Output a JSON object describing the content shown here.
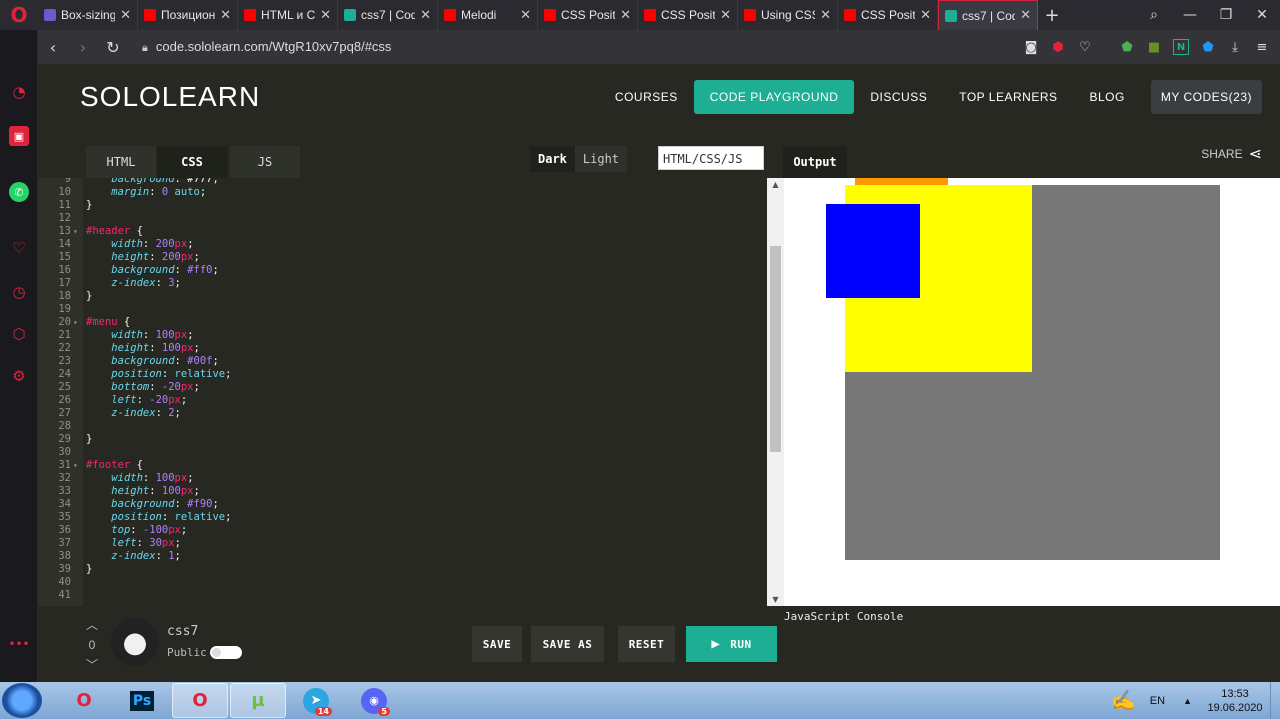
{
  "browser": {
    "tabs": [
      {
        "label": "Box-sizing",
        "color": "#6a5acd"
      },
      {
        "label": "Позицион",
        "color": "#ff0000"
      },
      {
        "label": "HTML и C",
        "color": "#ff0000"
      },
      {
        "label": "css7 | Cod",
        "color": "#1dae93"
      },
      {
        "label": "Melodi",
        "color": "#ff0000"
      },
      {
        "label": "CSS Positi",
        "color": "#ff0000"
      },
      {
        "label": "CSS Positi",
        "color": "#ff0000"
      },
      {
        "label": "Using CSS",
        "color": "#ff0000"
      },
      {
        "label": "CSS Positi",
        "color": "#ff0000"
      },
      {
        "label": "css7 | Cod",
        "color": "#1dae93"
      }
    ],
    "url": "code.sololearn.com/WtgR10xv7pq8/#css"
  },
  "header": {
    "logo": "SOLOLEARN",
    "nav": {
      "courses": "COURSES",
      "playground": "CODE PLAYGROUND",
      "discuss": "DISCUSS",
      "top": "TOP LEARNERS",
      "blog": "BLOG",
      "mycodes": "MY CODES(23)"
    }
  },
  "editor": {
    "tabs": {
      "html": "HTML",
      "css": "CSS",
      "js": "JS"
    },
    "theme": {
      "dark": "Dark",
      "light": "Light"
    },
    "lang": "HTML/CSS/JS",
    "output_tab": "Output",
    "share": "SHARE"
  },
  "code": {
    "lines": [
      {
        "n": "9",
        "html": "    <span class='prop'>background</span>: #777;"
      },
      {
        "n": "10",
        "html": "    <span class='prop'>margin</span>: <span class='num'>0</span> <span class='val'>auto</span>;"
      },
      {
        "n": "11",
        "html": "}"
      },
      {
        "n": "12",
        "html": ""
      },
      {
        "n": "13",
        "fold": true,
        "html": "<span class='sel'>#header</span> {"
      },
      {
        "n": "14",
        "html": "    <span class='prop'>width</span>: <span class='num'>200</span><span class='unit'>px</span>;"
      },
      {
        "n": "15",
        "html": "    <span class='prop'>height</span>: <span class='num'>200</span><span class='unit'>px</span>;"
      },
      {
        "n": "16",
        "html": "    <span class='prop'>background</span>: <span class='kw'>#ff0</span>;"
      },
      {
        "n": "17",
        "html": "    <span class='prop'>z-index</span>: <span class='num'>3</span>;"
      },
      {
        "n": "18",
        "html": "}"
      },
      {
        "n": "19",
        "html": ""
      },
      {
        "n": "20",
        "fold": true,
        "html": "<span class='sel'>#menu</span> {"
      },
      {
        "n": "21",
        "html": "    <span class='prop'>width</span>: <span class='num'>100</span><span class='unit'>px</span>;"
      },
      {
        "n": "22",
        "html": "    <span class='prop'>height</span>: <span class='num'>100</span><span class='unit'>px</span>;"
      },
      {
        "n": "23",
        "html": "    <span class='prop'>background</span>: <span class='kw'>#00f</span>;"
      },
      {
        "n": "24",
        "html": "    <span class='prop'>position</span>: <span class='val'>relative</span>;"
      },
      {
        "n": "25",
        "html": "    <span class='prop'>bottom</span>: <span class='num'>-20</span><span class='unit'>px</span>;"
      },
      {
        "n": "26",
        "html": "    <span class='prop'>left</span>: <span class='num'>-20</span><span class='unit'>px</span>;"
      },
      {
        "n": "27",
        "html": "    <span class='prop'>z-index</span>: <span class='num'>2</span>;"
      },
      {
        "n": "28",
        "html": ""
      },
      {
        "n": "29",
        "html": "}"
      },
      {
        "n": "30",
        "html": ""
      },
      {
        "n": "31",
        "fold": true,
        "html": "<span class='sel'>#footer</span> {"
      },
      {
        "n": "32",
        "html": "    <span class='prop'>width</span>: <span class='num'>100</span><span class='unit'>px</span>;"
      },
      {
        "n": "33",
        "html": "    <span class='prop'>height</span>: <span class='num'>100</span><span class='unit'>px</span>;"
      },
      {
        "n": "34",
        "html": "    <span class='prop'>background</span>: <span class='kw'>#f90</span>;"
      },
      {
        "n": "35",
        "html": "    <span class='prop'>position</span>: <span class='val'>relative</span>;"
      },
      {
        "n": "36",
        "html": "    <span class='prop'>top</span>: <span class='num'>-100</span><span class='unit'>px</span>;"
      },
      {
        "n": "37",
        "html": "    <span class='prop'>left</span>: <span class='num'>30</span><span class='unit'>px</span>;"
      },
      {
        "n": "38",
        "html": "    <span class='prop'>z-index</span>: <span class='num'>1</span>;"
      },
      {
        "n": "39",
        "html": "}"
      },
      {
        "n": "40",
        "html": ""
      },
      {
        "n": "41",
        "html": ""
      }
    ]
  },
  "bottom": {
    "votes": "0",
    "code_name": "css7",
    "public_label": "Public",
    "save": "SAVE",
    "save_as": "SAVE AS",
    "reset": "RESET",
    "run": "RUN",
    "console": "JavaScript Console"
  },
  "taskbar": {
    "lang": "EN",
    "time": "13:53",
    "date": "19.06.2020",
    "telegram_badge": "14",
    "discord_badge": "5"
  },
  "colors": {
    "accent": "#1dae93",
    "container": "#777777",
    "header_box": "#ffff00",
    "menu_box": "#0000ff",
    "footer_box": "#ff9900"
  }
}
